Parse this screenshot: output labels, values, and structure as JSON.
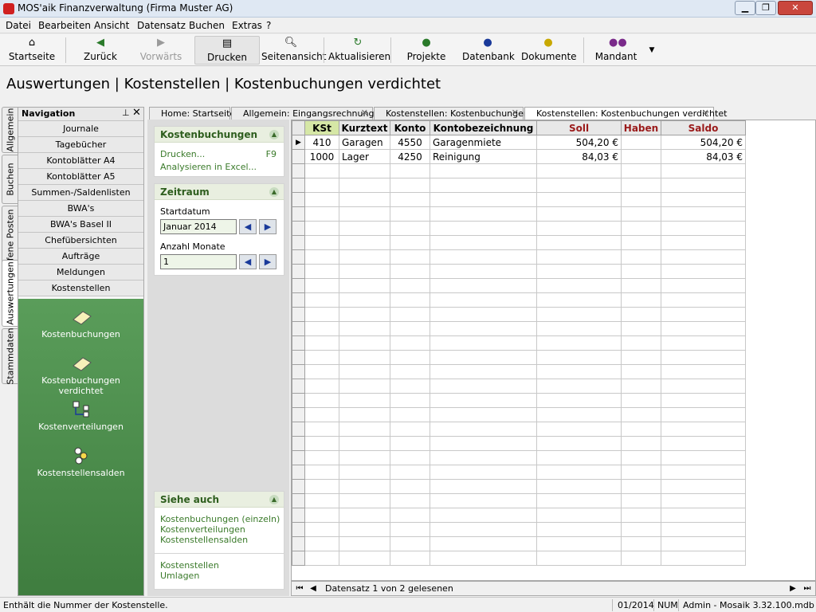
{
  "window": {
    "title": "MOS'aik Finanzverwaltung (Firma Muster AG)"
  },
  "menu": [
    "Datei",
    "Bearbeiten",
    "Ansicht",
    "Datensatz",
    "Buchen",
    "Extras",
    "?"
  ],
  "toolbar": {
    "home": "Startseite",
    "back": "Zurück",
    "forward": "Vorwärts",
    "print": "Drucken",
    "preview": "Seitenansicht",
    "refresh": "Aktualisieren",
    "projects": "Projekte",
    "database": "Datenbank",
    "documents": "Dokumente",
    "client": "Mandant"
  },
  "heading": "Auswertungen | Kostenstellen | Kostenbuchungen verdichtet",
  "vtabs": [
    "Allgemein",
    "Buchen",
    "Offene Posten",
    "Auswertungen",
    "Stammdaten"
  ],
  "nav": {
    "title": "Navigation",
    "items": [
      "Journale",
      "Tagebücher",
      "Kontoblätter A4",
      "Kontoblätter A5",
      "Summen-/Saldenlisten",
      "BWA's",
      "BWA's Basel II",
      "Chefübersichten",
      "Aufträge",
      "Meldungen",
      "Kostenstellen"
    ],
    "tiles": [
      "Kostenbuchungen",
      "Kostenbuchungen verdichtet",
      "Kostenverteilungen",
      "Kostenstellensalden"
    ]
  },
  "doctabs": [
    "Home: Startseite",
    "Allgemein: Eingangsrechnungen",
    "Kostenstellen: Kostenbuchungen",
    "Kostenstellen: Kostenbuchungen verdichtet"
  ],
  "task": {
    "box1": {
      "title": "Kostenbuchungen",
      "print": "Drucken...",
      "print_key": "F9",
      "excel": "Analysieren in Excel..."
    },
    "box2": {
      "title": "Zeitraum",
      "start_label": "Startdatum",
      "start_value": "Januar 2014",
      "months_label": "Anzahl Monate",
      "months_value": "1"
    },
    "box3": {
      "title": "Siehe auch",
      "links": [
        "Kostenbuchungen (einzeln)",
        "Kostenverteilungen",
        "Kostenstellensalden"
      ],
      "links2": [
        "Kostenstellen",
        "Umlagen"
      ]
    }
  },
  "grid": {
    "columns": [
      "KSt",
      "Kurztext",
      "Konto",
      "Kontobezeichnung",
      "Soll",
      "Haben",
      "Saldo"
    ],
    "rows": [
      {
        "kst": "410",
        "kurztext": "Garagen",
        "konto": "4550",
        "bez": "Garagenmiete",
        "soll": "504,20 €",
        "haben": "",
        "saldo": "504,20 €"
      },
      {
        "kst": "1000",
        "kurztext": "Lager",
        "konto": "4250",
        "bez": "Reinigung",
        "soll": "84,03 €",
        "haben": "",
        "saldo": "84,03 €"
      }
    ],
    "record_status": "Datensatz 1 von 2 gelesenen"
  },
  "status": {
    "hint": "Enthält die Nummer der Kostenstelle.",
    "period": "01/2014",
    "num": "NUM",
    "user": "Admin - Mosaik 3.32.100.mdb"
  },
  "colors": {
    "accent_green": "#4f8f4f",
    "header_red": "#9a1a1a",
    "selected_col": "#d6e7a6",
    "link_green": "#3a7a2a"
  }
}
